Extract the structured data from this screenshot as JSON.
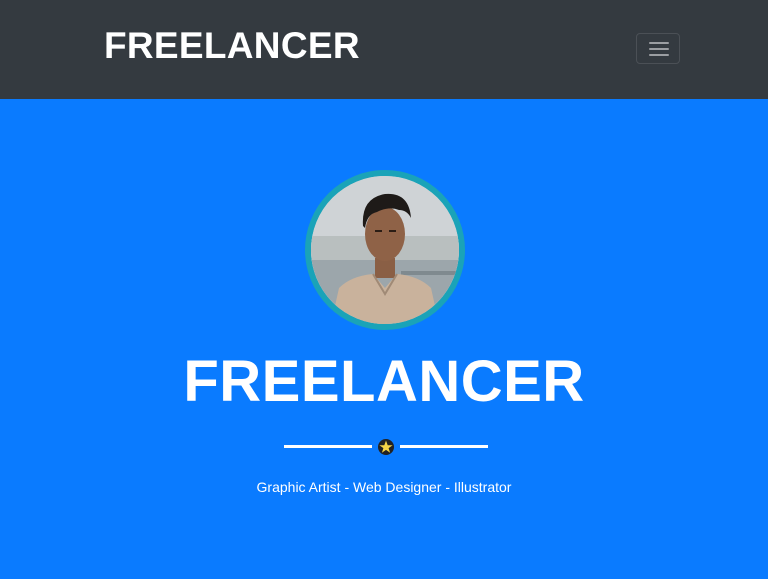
{
  "navbar": {
    "brand": "FREELANCER",
    "toggle_icon": "hamburger-menu-icon",
    "background": "#343a40"
  },
  "masthead": {
    "background": "#0a7bff",
    "avatar_border_color": "#1aa3b8",
    "title": "FREELANCER",
    "divider_icon": "star-icon",
    "subtitle": "Graphic Artist - Web Designer - Illustrator"
  }
}
